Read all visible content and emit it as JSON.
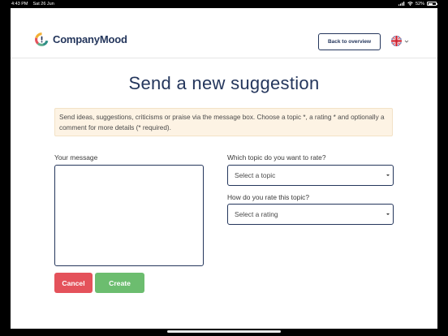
{
  "status_bar": {
    "time": "4:43 PM",
    "date": "Sat 26 Jun",
    "battery": "52%",
    "battery_level": 0.52
  },
  "header": {
    "brand": "CompanyMood",
    "back_label": "Back to overview",
    "language": "English (UK)"
  },
  "page": {
    "title": "Send a new suggestion",
    "info": "Send ideas, suggestions, criticisms or praise via the message box. Choose a topic *, a rating * and optionally a comment for more details (* required)."
  },
  "form": {
    "message_label": "Your message",
    "message_value": "",
    "topic_label": "Which topic do you want to rate?",
    "topic_placeholder": "Select a topic",
    "rating_label": "How do you rate this topic?",
    "rating_placeholder": "Select a rating",
    "cancel_label": "Cancel",
    "create_label": "Create"
  },
  "colors": {
    "brand_navy": "#24365c",
    "cancel_red": "#e4525b",
    "create_green": "#6cbd6f",
    "info_bg": "#fdf3e4"
  },
  "icons": [
    "signal-icon",
    "wifi-icon",
    "battery-icon",
    "company-mood-logo-icon",
    "uk-flag-icon",
    "chevron-down-icon",
    "dropdown-caret-icon"
  ]
}
